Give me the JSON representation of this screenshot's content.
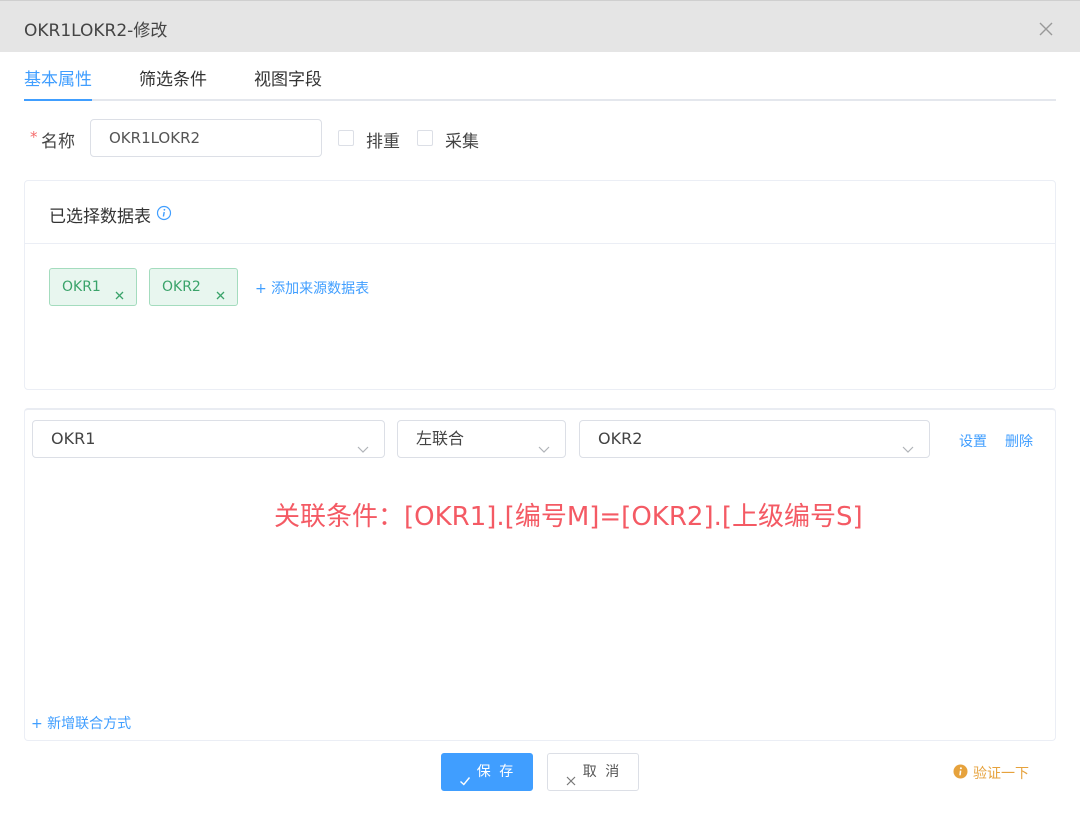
{
  "dialog": {
    "title": "OKR1LOKR2-修改",
    "close_icon": "close-icon"
  },
  "tabs": [
    {
      "label": "基本属性",
      "active": true
    },
    {
      "label": "筛选条件",
      "active": false
    },
    {
      "label": "视图字段",
      "active": false
    }
  ],
  "form": {
    "required_mark": "*",
    "name_label": "名称",
    "name_value": "OKR1LOKR2",
    "checkbox_dedupe": {
      "label": "排重",
      "checked": false
    },
    "checkbox_collect": {
      "label": "采集",
      "checked": false
    }
  },
  "selected_tables": {
    "title": "已选择数据表",
    "info_icon": "info-icon",
    "tags": [
      {
        "label": "OKR1"
      },
      {
        "label": "OKR2"
      }
    ],
    "add_source_label": "+ 添加来源数据表"
  },
  "join": {
    "left_table": "OKR1",
    "join_type": "左联合",
    "right_table": "OKR2",
    "settings_label": "设置",
    "delete_label": "删除",
    "condition_text": "关联条件：[OKR1].[编号M]=[OKR2].[上级编号S]",
    "add_join_label": "+ 新增联合方式"
  },
  "footer": {
    "save_label": "保 存",
    "cancel_label": "取 消",
    "verify_label": "验证一下"
  },
  "colors": {
    "accent": "#409eff",
    "tag_green": "#3aa36a",
    "condition_red": "#f45a64",
    "warning": "#e6a23c"
  }
}
